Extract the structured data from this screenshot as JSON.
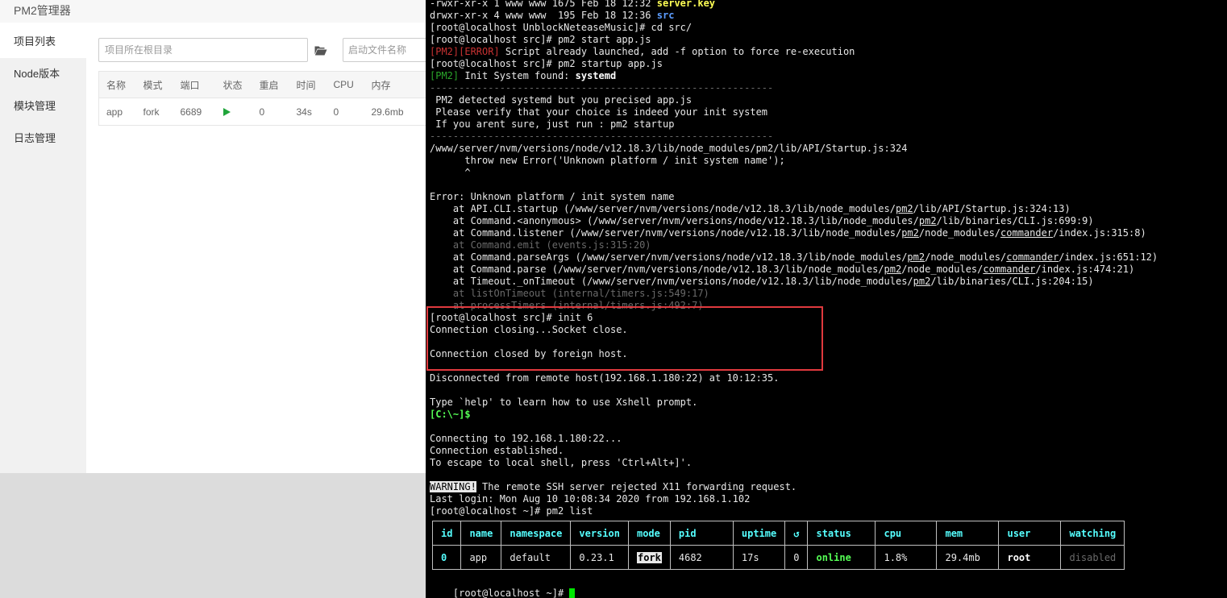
{
  "pm2_manager": {
    "title": "PM2管理器",
    "sidebar": [
      {
        "label": "项目列表",
        "active": true
      },
      {
        "label": "Node版本",
        "active": false
      },
      {
        "label": "模块管理",
        "active": false
      },
      {
        "label": "日志管理",
        "active": false
      }
    ],
    "path_input_placeholder": "项目所在根目录",
    "folder_icon": "folder-open-icon",
    "start_file_placeholder": "启动文件名称",
    "table": {
      "headers": [
        "名称",
        "模式",
        "端口",
        "状态",
        "重启",
        "时间",
        "CPU",
        "内存"
      ],
      "rows": [
        {
          "name": "app",
          "mode": "fork",
          "port": "6689",
          "status_icon": "play-icon",
          "restarts": "0",
          "time": "34s",
          "cpu": "0",
          "memory": "29.6mb"
        }
      ]
    },
    "colors": {
      "status_running": "#20a53a",
      "sidebar_bg": "#f1f1f1"
    }
  },
  "terminal": {
    "lines": [
      [
        {
          "t": "-rwxr-xr-x 1 www www 1675 Feb 18 12:32 "
        },
        {
          "t": "server.key",
          "c": "yellow"
        }
      ],
      [
        {
          "t": "drwxr-xr-x 4 www www  195 Feb 18 12:36 "
        },
        {
          "t": "src",
          "c": "blue"
        }
      ],
      [
        {
          "t": "[root@localhost UnblockNeteaseMusic]# cd src/"
        }
      ],
      [
        {
          "t": "[root@localhost src]# pm2 start app.js"
        }
      ],
      [
        {
          "t": "[PM2][ERROR]",
          "c": "red"
        },
        {
          "t": " Script already launched, add -f option to force re-execution"
        }
      ],
      [
        {
          "t": "[root@localhost src]# pm2 startup app.js"
        }
      ],
      [
        {
          "t": "[PM2]",
          "c": "green"
        },
        {
          "t": " Init System found: "
        },
        {
          "t": "systemd",
          "c": "bold"
        }
      ],
      [
        {
          "t": "-----------------------------------------------------------",
          "c": "dim"
        }
      ],
      [
        {
          "t": " PM2 detected systemd but you precised app.js"
        }
      ],
      [
        {
          "t": " Please verify that your choice is indeed your init system"
        }
      ],
      [
        {
          "t": " If you arent sure, just run : pm2 startup"
        }
      ],
      [
        {
          "t": "-----------------------------------------------------------",
          "c": "dim"
        }
      ],
      [
        {
          "t": "/www/server/nvm/versions/node/v12.18.3/lib/node_modules/pm2/lib/API/Startup.js:324"
        }
      ],
      [
        {
          "t": "      throw new Error('Unknown platform / init system name');"
        }
      ],
      [
        {
          "t": "      ^"
        }
      ],
      [
        {
          "t": ""
        }
      ],
      [
        {
          "t": "Error: Unknown platform / init system name"
        }
      ],
      [
        {
          "t": "    at API.CLI.startup (/www/server/nvm/versions/node/v12.18.3/lib/node_modules/"
        },
        {
          "t": "pm2",
          "c": "ul"
        },
        {
          "t": "/lib/API/Startup.js:324:13)"
        }
      ],
      [
        {
          "t": "    at Command.<anonymous> (/www/server/nvm/versions/node/v12.18.3/lib/node_modules/"
        },
        {
          "t": "pm2",
          "c": "ul"
        },
        {
          "t": "/lib/binaries/CLI.js:699:9)"
        }
      ],
      [
        {
          "t": "    at Command.listener (/www/server/nvm/versions/node/v12.18.3/lib/node_modules/"
        },
        {
          "t": "pm2",
          "c": "ul"
        },
        {
          "t": "/node_modules/"
        },
        {
          "t": "commander",
          "c": "ul"
        },
        {
          "t": "/index.js:315:8)"
        }
      ],
      [
        {
          "t": "    at Command.emit (events.js:315:20)",
          "c": "dim"
        }
      ],
      [
        {
          "t": "    at Command.parseArgs (/www/server/nvm/versions/node/v12.18.3/lib/node_modules/"
        },
        {
          "t": "pm2",
          "c": "ul"
        },
        {
          "t": "/node_modules/"
        },
        {
          "t": "commander",
          "c": "ul"
        },
        {
          "t": "/index.js:651:12)"
        }
      ],
      [
        {
          "t": "    at Command.parse (/www/server/nvm/versions/node/v12.18.3/lib/node_modules/"
        },
        {
          "t": "pm2",
          "c": "ul"
        },
        {
          "t": "/node_modules/"
        },
        {
          "t": "commander",
          "c": "ul"
        },
        {
          "t": "/index.js:474:21)"
        }
      ],
      [
        {
          "t": "    at Timeout._onTimeout (/www/server/nvm/versions/node/v12.18.3/lib/node_modules/"
        },
        {
          "t": "pm2",
          "c": "ul"
        },
        {
          "t": "/lib/binaries/CLI.js:204:15)"
        }
      ],
      [
        {
          "t": "    at listOnTimeout (internal/timers.js:549:17)",
          "c": "dim"
        }
      ],
      [
        {
          "t": "    at processTimers (internal/timers.js:492:7)",
          "c": "dim"
        }
      ],
      [
        {
          "t": "[root@localhost src]# init 6"
        }
      ],
      [
        {
          "t": "Connection closing...Socket close."
        }
      ],
      [
        {
          "t": ""
        }
      ],
      [
        {
          "t": "Connection closed by foreign host."
        }
      ],
      [
        {
          "t": ""
        }
      ],
      [
        {
          "t": "Disconnected from remote host(192.168.1.180:22) at 10:12:35."
        }
      ],
      [
        {
          "t": ""
        }
      ],
      [
        {
          "t": "Type `help' to learn how to use Xshell prompt."
        }
      ],
      [
        {
          "t": "[C:\\~]$",
          "c": "prompt"
        }
      ],
      [
        {
          "t": ""
        }
      ],
      [
        {
          "t": "Connecting to 192.168.1.180:22..."
        }
      ],
      [
        {
          "t": "Connection established."
        }
      ],
      [
        {
          "t": "To escape to local shell, press 'Ctrl+Alt+]'."
        }
      ],
      [
        {
          "t": ""
        }
      ],
      [
        {
          "t": "WARNING!",
          "c": "inv"
        },
        {
          "t": " The remote SSH server rejected X11 forwarding request."
        }
      ],
      [
        {
          "t": "Last login: Mon Aug 10 10:08:34 2020 from 192.168.1.102"
        }
      ],
      [
        {
          "t": "[root@localhost ~]# pm2 list"
        }
      ]
    ],
    "pm2_list": {
      "headers": [
        "id",
        "name",
        "namespace",
        "version",
        "mode",
        "pid",
        "uptime",
        "↺",
        "status",
        "cpu",
        "mem",
        "user",
        "watching"
      ],
      "rows": [
        [
          "0",
          "app",
          "default",
          "0.23.1",
          "fork",
          "4682",
          "17s",
          "0",
          "online",
          "1.8%",
          "29.4mb",
          "root",
          "disabled"
        ]
      ]
    },
    "final_prompt": "[root@localhost ~]# ",
    "colors": {
      "background": "#000000",
      "highlight_box": "#e0393e",
      "cursor": "#00e600",
      "table_header": "#55ffff"
    }
  }
}
